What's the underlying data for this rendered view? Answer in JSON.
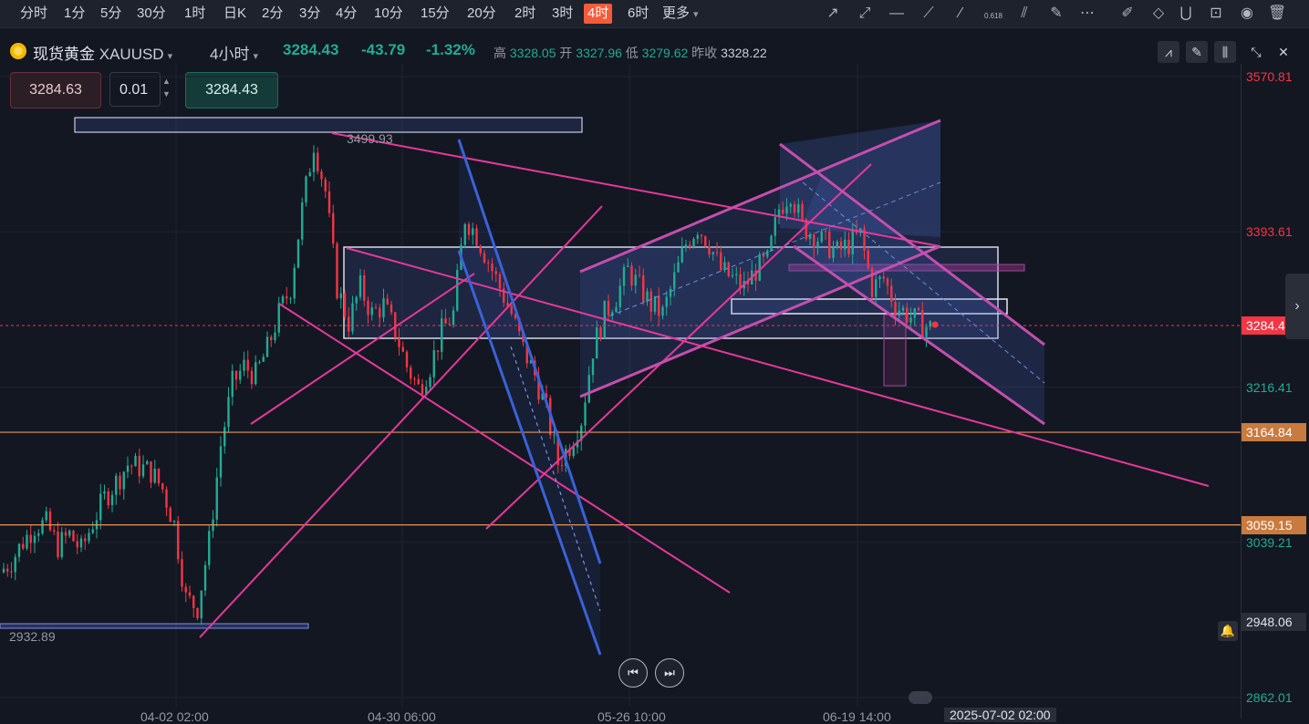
{
  "toolbar": {
    "timeframes": [
      "分时",
      "1分",
      "5分",
      "30分",
      "1时",
      "日K",
      "2分",
      "3分",
      "4分",
      "10分",
      "15分",
      "20分",
      "2时",
      "3时",
      "4时",
      "6时"
    ],
    "active_timeframe": "4时",
    "more_label": "更多",
    "fib_label": "0.618"
  },
  "symbol": {
    "name": "现货黄金",
    "code": "XAUUSD",
    "interval": "4小时",
    "last": "3284.43",
    "change": "-43.79",
    "change_pct": "-1.32%",
    "high_label": "高",
    "high": "3328.05",
    "open_label": "开",
    "open": "3327.96",
    "low_label": "低",
    "low": "3279.62",
    "prev_close_label": "昨收",
    "prev_close": "3328.22"
  },
  "order": {
    "sell_price": "3284.63",
    "quantity": "0.01",
    "buy_price": "3284.43"
  },
  "colors": {
    "accent": "#f55a3a",
    "up": "#22ab94",
    "down": "#f23645",
    "trendline": "#e5399a",
    "channel_blue": "#3a62d8",
    "level_orange": "#e8935a"
  },
  "chart_data": {
    "type": "candlestick",
    "instrument": "XAUUSD",
    "interval": "4H",
    "x_ticks": [
      "04-02 02:00",
      "04-30 06:00",
      "05-26 10:00",
      "06-19 14:00",
      "2025-07-02 02:00"
    ],
    "y_ticks": [
      3570.81,
      3393.61,
      3216.41,
      3039.21,
      2862.01
    ],
    "ylim": [
      2840,
      3600
    ],
    "last_price": 3284.43,
    "horizontal_levels": [
      3164.84,
      3059.15
    ],
    "alert_level": 2948.06,
    "annotations": [
      {
        "text": "3499.93",
        "price": 3499.93
      },
      {
        "text": "2932.89",
        "price": 2932.89
      }
    ],
    "closes_approx": [
      3005,
      3018,
      3040,
      3058,
      3060,
      3035,
      3048,
      3030,
      3062,
      3090,
      3108,
      3128,
      3125,
      3120,
      3100,
      3060,
      2975,
      2965,
      3040,
      3150,
      3220,
      3240,
      3230,
      3260,
      3300,
      3330,
      3420,
      3495,
      3440,
      3330,
      3290,
      3330,
      3300,
      3310,
      3280,
      3240,
      3215,
      3240,
      3280,
      3300,
      3410,
      3390,
      3360,
      3330,
      3300,
      3260,
      3230,
      3190,
      3130,
      3150,
      3180,
      3260,
      3300,
      3320,
      3350,
      3330,
      3310,
      3300,
      3340,
      3380,
      3400,
      3380,
      3350,
      3340,
      3330,
      3350,
      3360,
      3420,
      3440,
      3400,
      3390,
      3380,
      3370,
      3380,
      3390,
      3330,
      3340,
      3310,
      3300,
      3290,
      3284
    ]
  }
}
